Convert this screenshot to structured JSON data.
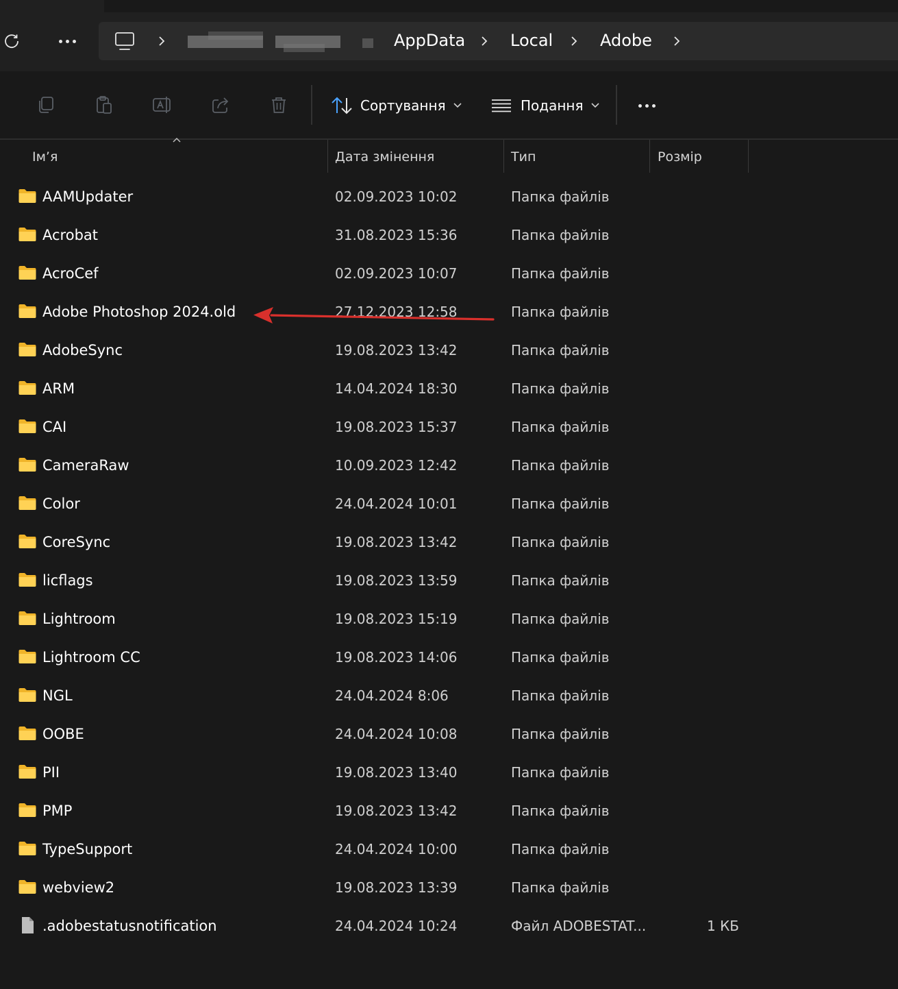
{
  "address_bar": {
    "refresh_icon": "refresh-icon",
    "more_icon": "more-horizontal-icon",
    "pc_icon": "this-pc-icon",
    "hidden_crumb_icon": "blurred-username",
    "crumbs": [
      "AppData",
      "Local",
      "Adobe"
    ]
  },
  "toolbar": {
    "icons": [
      "copy-icon",
      "paste-icon",
      "rename-icon",
      "share-icon",
      "delete-icon"
    ],
    "sort_label": "Сортування",
    "view_label": "Подання",
    "more_icon": "more-horizontal-icon"
  },
  "columns": {
    "name": "Ім’я",
    "date": "Дата змінення",
    "type": "Тип",
    "size": "Розмір"
  },
  "files": [
    {
      "name": "AAMUpdater",
      "date": "02.09.2023 10:02",
      "type": "Папка файлів",
      "size": "",
      "kind": "folder"
    },
    {
      "name": "Acrobat",
      "date": "31.08.2023 15:36",
      "type": "Папка файлів",
      "size": "",
      "kind": "folder"
    },
    {
      "name": "AcroCef",
      "date": "02.09.2023 10:07",
      "type": "Папка файлів",
      "size": "",
      "kind": "folder"
    },
    {
      "name": "Adobe Photoshop 2024.old",
      "date": "27.12.2023 12:58",
      "type": "Папка файлів",
      "size": "",
      "kind": "folder"
    },
    {
      "name": "AdobeSync",
      "date": "19.08.2023 13:42",
      "type": "Папка файлів",
      "size": "",
      "kind": "folder"
    },
    {
      "name": "ARM",
      "date": "14.04.2024 18:30",
      "type": "Папка файлів",
      "size": "",
      "kind": "folder"
    },
    {
      "name": "CAI",
      "date": "19.08.2023 15:37",
      "type": "Папка файлів",
      "size": "",
      "kind": "folder"
    },
    {
      "name": "CameraRaw",
      "date": "10.09.2023 12:42",
      "type": "Папка файлів",
      "size": "",
      "kind": "folder"
    },
    {
      "name": "Color",
      "date": "24.04.2024 10:01",
      "type": "Папка файлів",
      "size": "",
      "kind": "folder"
    },
    {
      "name": "CoreSync",
      "date": "19.08.2023 13:42",
      "type": "Папка файлів",
      "size": "",
      "kind": "folder"
    },
    {
      "name": "licflags",
      "date": "19.08.2023 13:59",
      "type": "Папка файлів",
      "size": "",
      "kind": "folder"
    },
    {
      "name": "Lightroom",
      "date": "19.08.2023 15:19",
      "type": "Папка файлів",
      "size": "",
      "kind": "folder"
    },
    {
      "name": "Lightroom CC",
      "date": "19.08.2023 14:06",
      "type": "Папка файлів",
      "size": "",
      "kind": "folder"
    },
    {
      "name": "NGL",
      "date": "24.04.2024 8:06",
      "type": "Папка файлів",
      "size": "",
      "kind": "folder"
    },
    {
      "name": "OOBE",
      "date": "24.04.2024 10:08",
      "type": "Папка файлів",
      "size": "",
      "kind": "folder"
    },
    {
      "name": "PII",
      "date": "19.08.2023 13:40",
      "type": "Папка файлів",
      "size": "",
      "kind": "folder"
    },
    {
      "name": "PMP",
      "date": "19.08.2023 13:42",
      "type": "Папка файлів",
      "size": "",
      "kind": "folder"
    },
    {
      "name": "TypeSupport",
      "date": "24.04.2024 10:00",
      "type": "Папка файлів",
      "size": "",
      "kind": "folder"
    },
    {
      "name": "webview2",
      "date": "19.08.2023 13:39",
      "type": "Папка файлів",
      "size": "",
      "kind": "folder"
    },
    {
      "name": ".adobestatusnotification",
      "date": "24.04.2024 10:24",
      "type": "Файл ADOBESTAT...",
      "size": "1 КБ",
      "kind": "file"
    }
  ],
  "annotation": {
    "points_to": "Adobe Photoshop 2024.old",
    "color": "#d9302c"
  },
  "colors": {
    "folder": "#f5c542",
    "background": "#191919",
    "file_icon": "#bdbdbd"
  }
}
